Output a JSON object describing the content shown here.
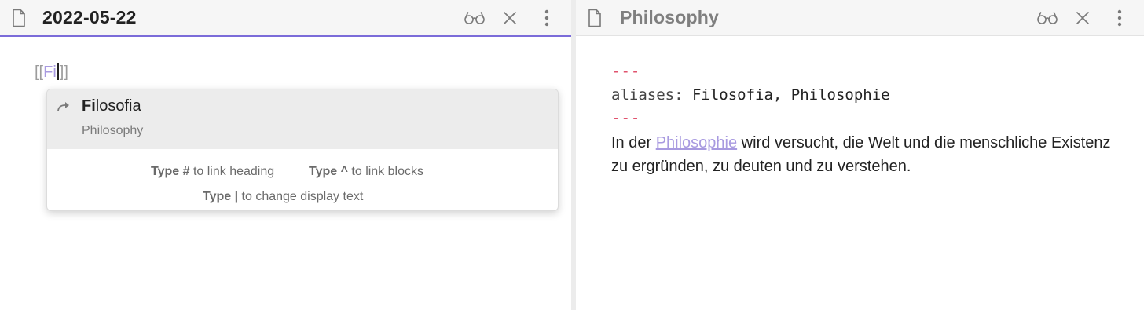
{
  "left_pane": {
    "title": "2022-05-22",
    "editor": {
      "open_brackets": "[[",
      "typed": "Fi",
      "close_brackets": "]]"
    },
    "suggestion": {
      "match": "Fi",
      "rest": "losofia",
      "subtitle": "Philosophy"
    },
    "hints": {
      "heading_kw": "Type #",
      "heading_text": " to link heading",
      "blocks_kw": "Type ^",
      "blocks_text": " to link blocks",
      "display_kw": "Type |",
      "display_text": " to change display text"
    }
  },
  "right_pane": {
    "title": "Philosophy",
    "frontmatter": {
      "dash": "---",
      "key": "aliases:",
      "value": " Filosofia, Philosophie"
    },
    "body": {
      "before": "In der ",
      "link": "Philosophie",
      "after": " wird versucht, die Welt und die menschliche Existenz zu ergründen, zu deuten und zu verstehen."
    }
  },
  "icons": {
    "file": "file-icon",
    "reading_view": "glasses-icon",
    "close": "close-icon",
    "more": "more-vertical-icon",
    "alias": "alias-arrow-icon"
  },
  "colors": {
    "accent": "#7b6cd9",
    "link": "#a89ae0",
    "frontmatter_dash": "#e0536e"
  }
}
